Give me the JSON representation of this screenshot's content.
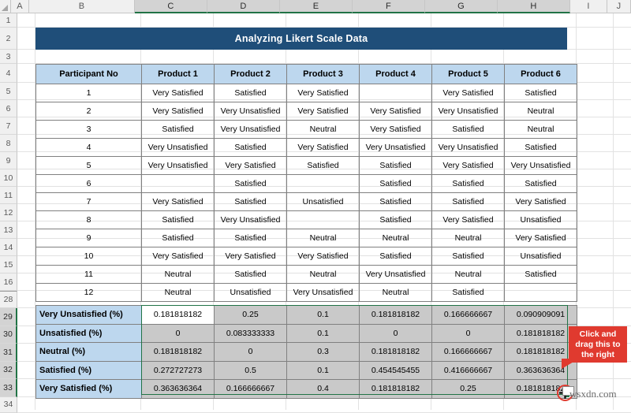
{
  "app": {
    "type": "spreadsheet",
    "title": "Analyzing Likert Scale Data"
  },
  "colors": {
    "banner_bg": "#1f4e79",
    "banner_text": "#ffffff",
    "header_bg": "#bdd7ee",
    "selection_green": "#217346",
    "selection_fill": "#c9c9c9",
    "callout_red": "#e03a2f",
    "grid_line": "#e2e2e2",
    "cell_border": "#808080"
  },
  "grid": {
    "column_headers": [
      "A",
      "B",
      "C",
      "D",
      "E",
      "F",
      "G",
      "H",
      "I",
      "J"
    ],
    "selected_columns": [
      "C",
      "D",
      "E",
      "F",
      "G",
      "H"
    ],
    "row_headers": [
      "1",
      "2",
      "3",
      "4",
      "5",
      "6",
      "7",
      "8",
      "9",
      "10",
      "11",
      "12",
      "13",
      "14",
      "15",
      "16",
      "28",
      "29",
      "30",
      "31",
      "32",
      "33",
      "34"
    ],
    "selected_rows": [
      "29",
      "30",
      "31",
      "32",
      "33"
    ],
    "hidden_rows_note": "17-27"
  },
  "banner": {
    "text": "Analyzing Likert Scale Data"
  },
  "likert_table": {
    "headers": [
      "Participant No",
      "Product 1",
      "Product 2",
      "Product 3",
      "Product 4",
      "Product 5",
      "Product 6"
    ],
    "rows": [
      [
        "1",
        "Very Satisfied",
        "Satisfied",
        "Very Satisfied",
        "",
        "Very Satisfied",
        "Satisfied"
      ],
      [
        "2",
        "Very Satisfied",
        "Very Unsatisfied",
        "Very Satisfied",
        "Very Satisfied",
        "Very Unsatisfied",
        "Neutral"
      ],
      [
        "3",
        "Satisfied",
        "Very Unsatisfied",
        "Neutral",
        "Very Satisfied",
        "Satisfied",
        "Neutral"
      ],
      [
        "4",
        "Very Unsatisfied",
        "Satisfied",
        "Very Satisfied",
        "Very Unsatisfied",
        "Very Unsatisfied",
        "Satisfied"
      ],
      [
        "5",
        "Very Unsatisfied",
        "Very Satisfied",
        "Satisfied",
        "Satisfied",
        "Very Satisfied",
        "Very Unsatisfied"
      ],
      [
        "6",
        "",
        "Satisfied",
        "",
        "Satisfied",
        "Satisfied",
        "Satisfied"
      ],
      [
        "7",
        "Very Satisfied",
        "Satisfied",
        "Unsatisfied",
        "Satisfied",
        "Satisfied",
        "Very Satisfied"
      ],
      [
        "8",
        "Satisfied",
        "Very Unsatisfied",
        "",
        "Satisfied",
        "Very Satisfied",
        "Unsatisfied"
      ],
      [
        "9",
        "Satisfied",
        "Satisfied",
        "Neutral",
        "Neutral",
        "Neutral",
        "Very Satisfied"
      ],
      [
        "10",
        "Very Satisfied",
        "Very Satisfied",
        "Very Satisfied",
        "Satisfied",
        "Satisfied",
        "Unsatisfied"
      ],
      [
        "11",
        "Neutral",
        "Satisfied",
        "Neutral",
        "Very Unsatisfied",
        "Neutral",
        "Satisfied"
      ],
      [
        "12",
        "Neutral",
        "Unsatisfied",
        "Very Unsatisfied",
        "Neutral",
        "Satisfied",
        ""
      ]
    ]
  },
  "percent_table": {
    "row_labels": [
      "Very Unsatisfied (%)",
      "Unsatisfied (%)",
      "Neutral (%)",
      "Satisfied (%)",
      "Very Satisfied (%)"
    ],
    "rows": [
      [
        "0.181818182",
        "0.25",
        "0.1",
        "0.181818182",
        "0.166666667",
        "0.090909091"
      ],
      [
        "0",
        "0.083333333",
        "0.1",
        "0",
        "0",
        "0.181818182"
      ],
      [
        "0.181818182",
        "0",
        "0.3",
        "0.181818182",
        "0.166666667",
        "0.181818182"
      ],
      [
        "0.272727273",
        "0.5",
        "0.1",
        "0.454545455",
        "0.416666667",
        "0.363636364"
      ],
      [
        "0.363636364",
        "0.166666667",
        "0.4",
        "0.181818182",
        "0.25",
        "0.181818182"
      ]
    ],
    "active_cell_value": "0.181818182",
    "selected_range": "C29:H33"
  },
  "callout": {
    "lines": [
      "Click and",
      "drag this to",
      "the right"
    ],
    "text": "Click and drag this to the right"
  },
  "watermark": {
    "text": "wsxdn.com"
  }
}
